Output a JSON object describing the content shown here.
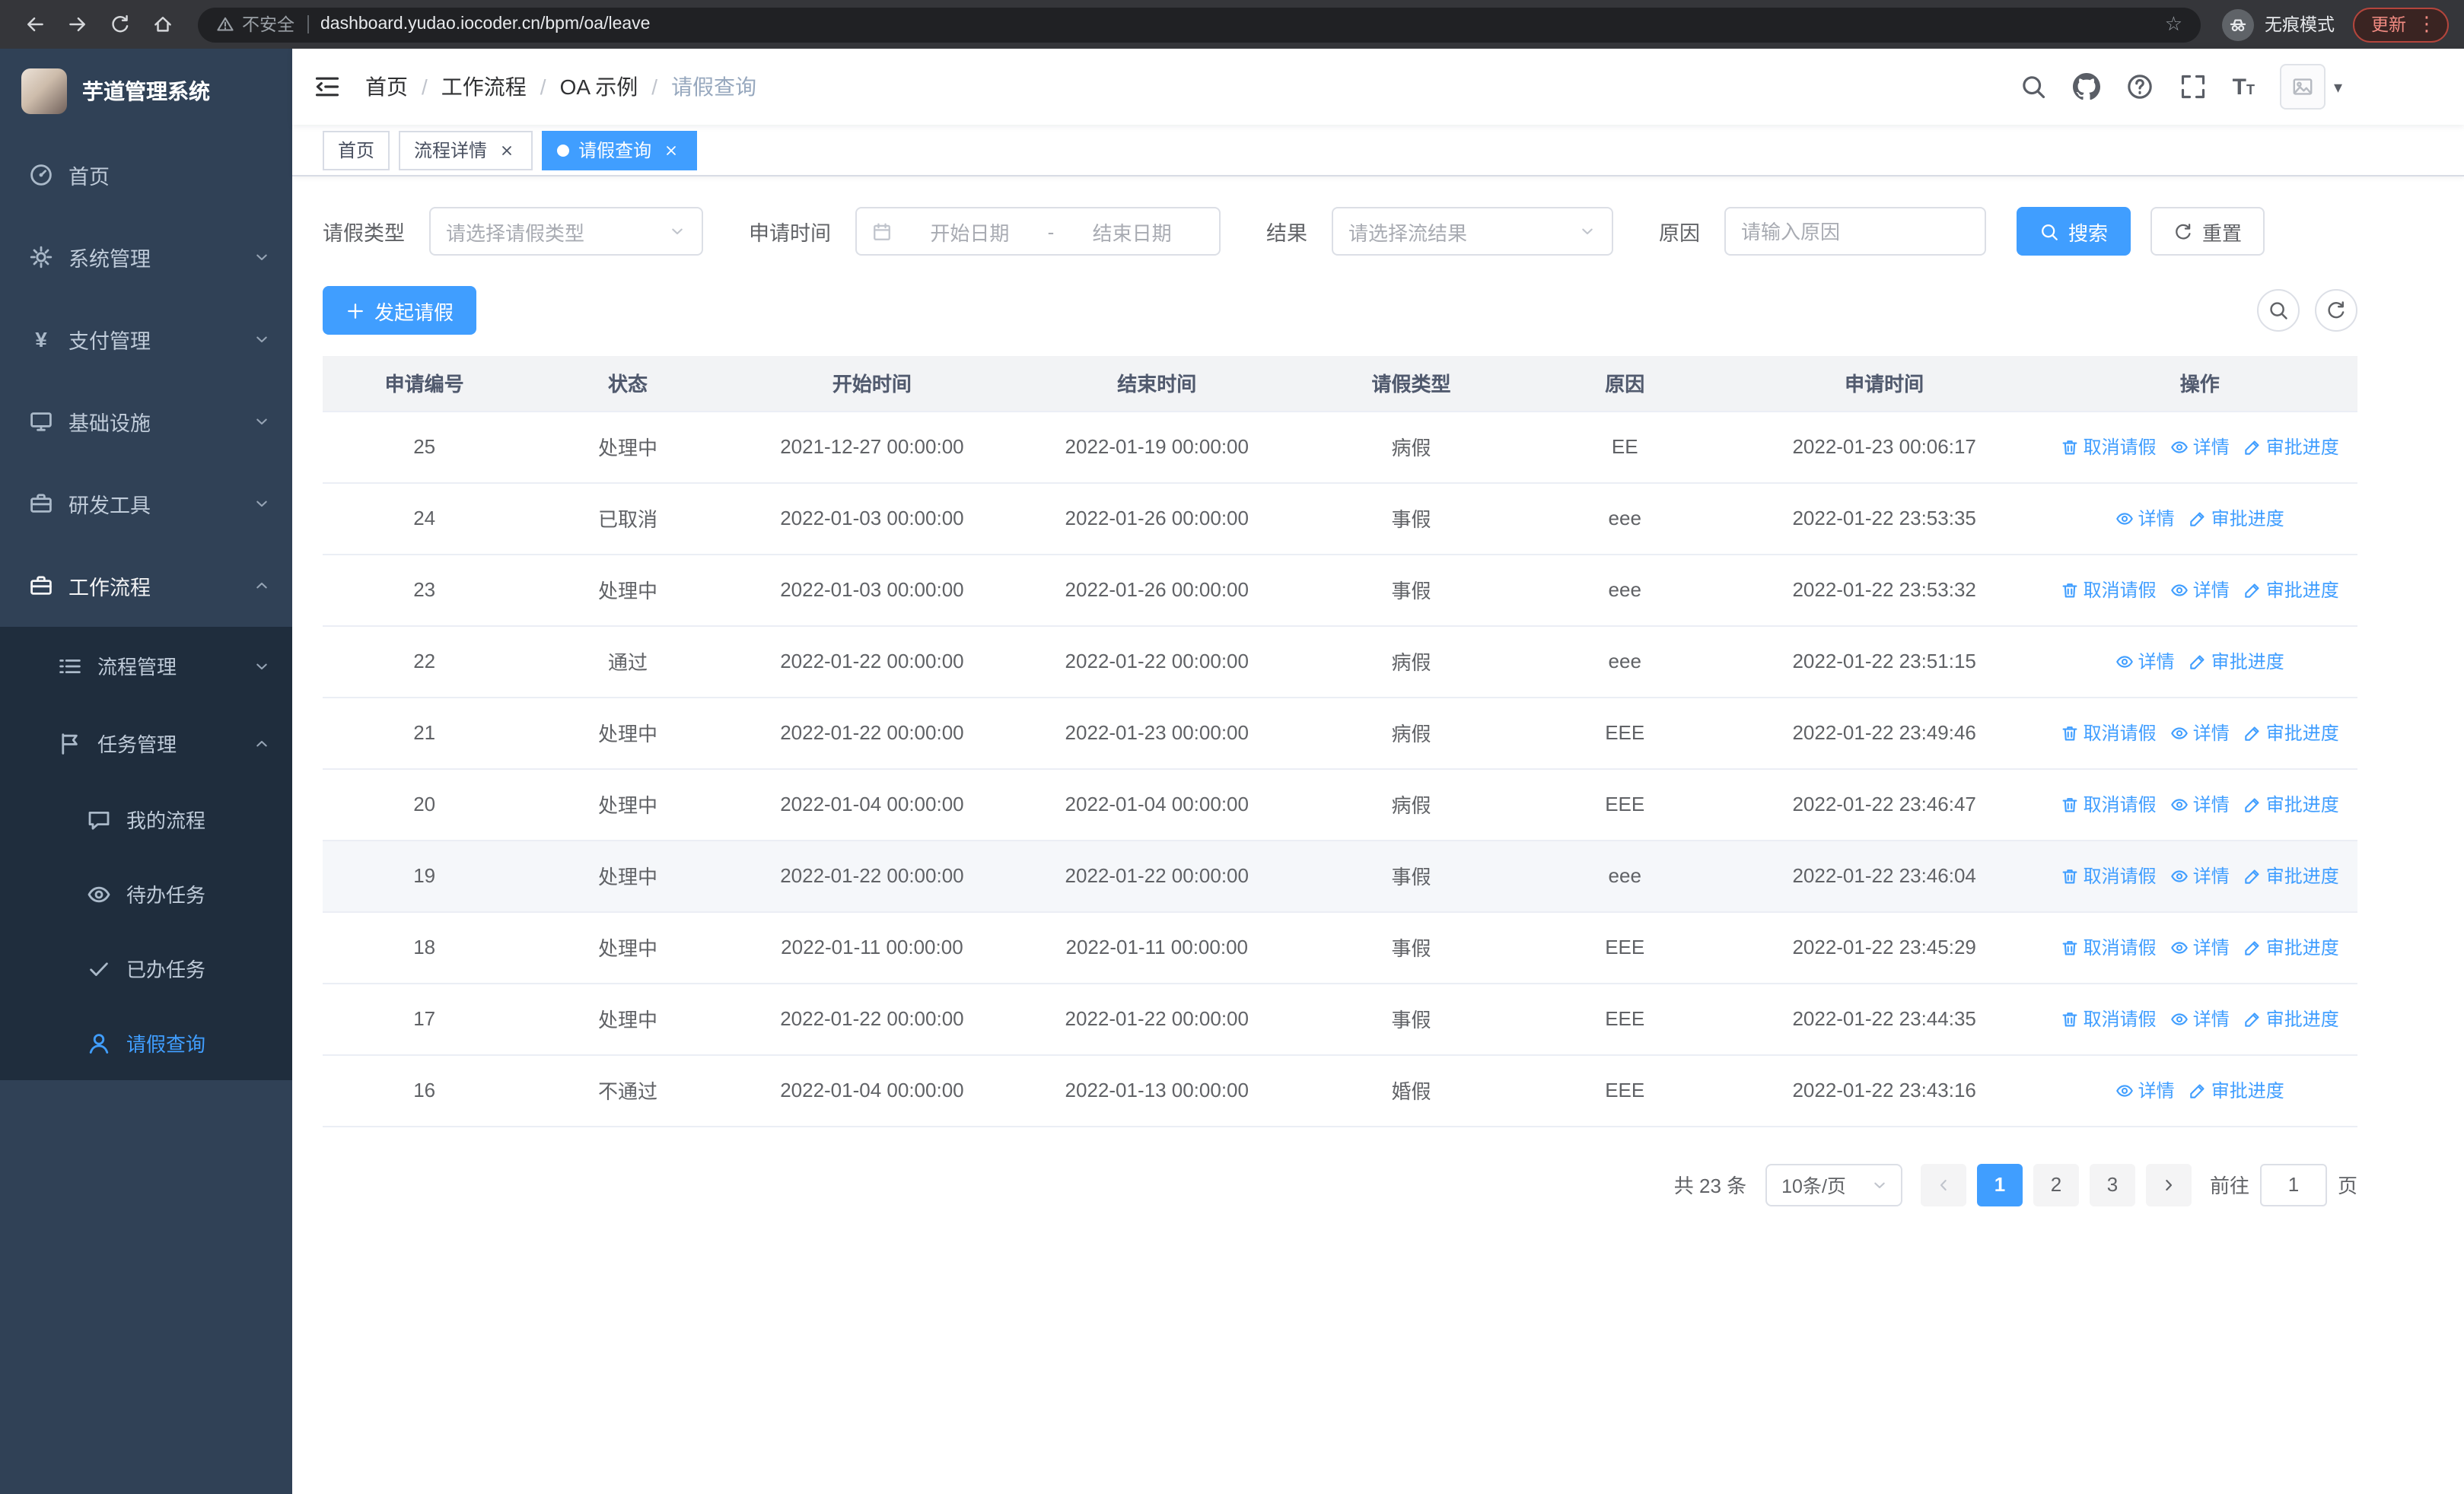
{
  "browser": {
    "security_label": "不安全",
    "url": "dashboard.yudao.iocoder.cn/bpm/oa/leave",
    "star_glyph": "☆",
    "incognito_label": "无痕模式",
    "update_label": "更新",
    "kebab_glyph": "⋮"
  },
  "sidebar": {
    "title": "芋道管理系统",
    "yen_glyph": "¥",
    "menu_top": [
      {
        "label": "首页"
      },
      {
        "label": "系统管理"
      },
      {
        "label": "支付管理"
      },
      {
        "label": "基础设施"
      },
      {
        "label": "研发工具"
      },
      {
        "label": "工作流程"
      }
    ],
    "menu_level2": [
      {
        "label": "流程管理"
      },
      {
        "label": "任务管理"
      }
    ],
    "menu_level3": [
      {
        "label": "我的流程"
      },
      {
        "label": "待办任务"
      },
      {
        "label": "已办任务"
      },
      {
        "label": "请假查询"
      }
    ]
  },
  "header": {
    "breadcrumbs": [
      "首页",
      "工作流程",
      "OA 示例",
      "请假查询"
    ],
    "separator": "/",
    "font_size_glyph": "T",
    "font_size_glyph_small": "T",
    "caret_glyph": "▾"
  },
  "tabs": [
    {
      "label": "首页"
    },
    {
      "label": "流程详情"
    },
    {
      "label": "请假查询"
    }
  ],
  "filters": {
    "leave_type_label": "请假类型",
    "leave_type_placeholder": "请选择请假类型",
    "time_label": "申请时间",
    "start_placeholder": "开始日期",
    "range_separator": "-",
    "end_placeholder": "结束日期",
    "result_label": "结果",
    "result_placeholder": "请选择流结果",
    "reason_label": "原因",
    "reason_placeholder": "请输入原因",
    "search_label": "搜索",
    "reset_label": "重置"
  },
  "toolbar": {
    "create_label": "发起请假"
  },
  "table": {
    "columns": [
      "申请编号",
      "状态",
      "开始时间",
      "结束时间",
      "请假类型",
      "原因",
      "申请时间",
      "操作"
    ],
    "ops": {
      "cancel": "取消请假",
      "detail": "详情",
      "progress": "审批进度"
    },
    "rows": [
      {
        "id": "25",
        "status": "处理中",
        "start": "2021-12-27 00:00:00",
        "end": "2022-01-19 00:00:00",
        "type": "病假",
        "reason": "EE",
        "applied": "2022-01-23 00:06:17"
      },
      {
        "id": "24",
        "status": "已取消",
        "start": "2022-01-03 00:00:00",
        "end": "2022-01-26 00:00:00",
        "type": "事假",
        "reason": "eee",
        "applied": "2022-01-22 23:53:35"
      },
      {
        "id": "23",
        "status": "处理中",
        "start": "2022-01-03 00:00:00",
        "end": "2022-01-26 00:00:00",
        "type": "事假",
        "reason": "eee",
        "applied": "2022-01-22 23:53:32"
      },
      {
        "id": "22",
        "status": "通过",
        "start": "2022-01-22 00:00:00",
        "end": "2022-01-22 00:00:00",
        "type": "病假",
        "reason": "eee",
        "applied": "2022-01-22 23:51:15"
      },
      {
        "id": "21",
        "status": "处理中",
        "start": "2022-01-22 00:00:00",
        "end": "2022-01-23 00:00:00",
        "type": "病假",
        "reason": "EEE",
        "applied": "2022-01-22 23:49:46"
      },
      {
        "id": "20",
        "status": "处理中",
        "start": "2022-01-04 00:00:00",
        "end": "2022-01-04 00:00:00",
        "type": "病假",
        "reason": "EEE",
        "applied": "2022-01-22 23:46:47"
      },
      {
        "id": "19",
        "status": "处理中",
        "start": "2022-01-22 00:00:00",
        "end": "2022-01-22 00:00:00",
        "type": "事假",
        "reason": "eee",
        "applied": "2022-01-22 23:46:04"
      },
      {
        "id": "18",
        "status": "处理中",
        "start": "2022-01-11 00:00:00",
        "end": "2022-01-11 00:00:00",
        "type": "事假",
        "reason": "EEE",
        "applied": "2022-01-22 23:45:29"
      },
      {
        "id": "17",
        "status": "处理中",
        "start": "2022-01-22 00:00:00",
        "end": "2022-01-22 00:00:00",
        "type": "事假",
        "reason": "EEE",
        "applied": "2022-01-22 23:44:35"
      },
      {
        "id": "16",
        "status": "不通过",
        "start": "2022-01-04 00:00:00",
        "end": "2022-01-13 00:00:00",
        "type": "婚假",
        "reason": "EEE",
        "applied": "2022-01-22 23:43:16"
      }
    ]
  },
  "pagination": {
    "total": "共 23 条",
    "page_size": "10条/页",
    "pages": [
      "1",
      "2",
      "3"
    ],
    "current_page": "1",
    "goto_label": "前往",
    "goto_value": "1",
    "goto_unit": "页"
  },
  "colors": {
    "accent": "#409eff",
    "sidebar_bg": "#304156",
    "submenu_bg": "#1f2d3d",
    "chrome_bg": "#35363a"
  }
}
